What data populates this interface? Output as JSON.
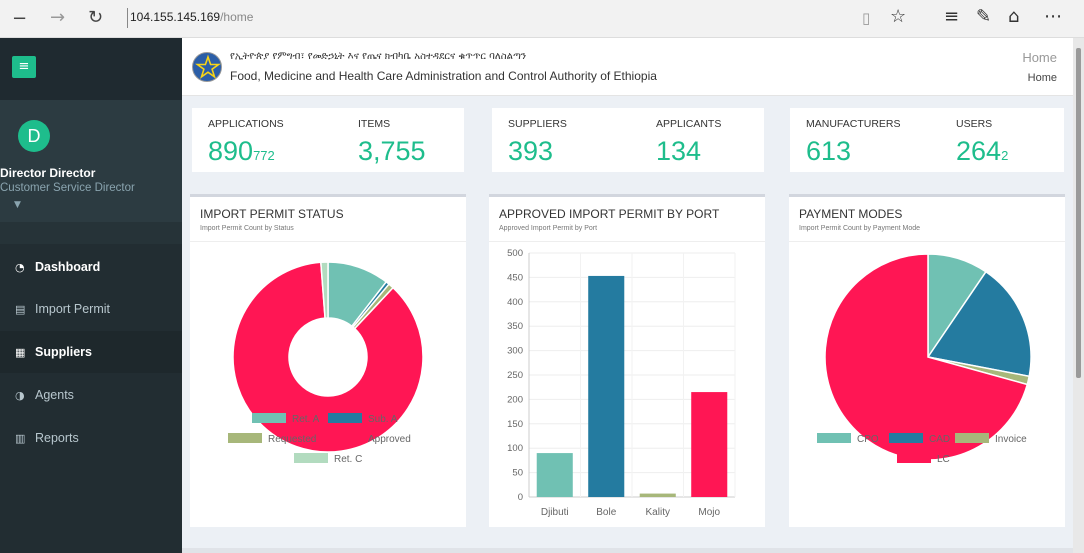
{
  "browser": {
    "url_host": "104.155.145.169",
    "url_path": "/home",
    "icons": [
      "minimize-icon",
      "forward-icon",
      "refresh-icon",
      "reading-view-icon",
      "favorite-star-icon",
      "hub-icon",
      "web-note-icon",
      "share-icon",
      "more-icon"
    ]
  },
  "sidebar": {
    "menu_icon": "≡",
    "user": {
      "initial": "D",
      "name": "Director Director",
      "role": "Customer Service Director"
    },
    "items": [
      {
        "label": "Dashboard",
        "icon": "dashboard-icon"
      },
      {
        "label": "Import Permit",
        "icon": "document-icon"
      },
      {
        "label": "Suppliers",
        "icon": "building-icon"
      },
      {
        "label": "Agents",
        "icon": "half-circle-icon"
      },
      {
        "label": "Reports",
        "icon": "bar-chart-icon"
      }
    ]
  },
  "header": {
    "amharic_title": "የኢትዮጵያ የምግብ፣ የመድኃኒት እና የጤና ክብካቤ አስተዳደርና ቁጥጥር ባለስልጣን",
    "english_title": "Food, Medicine and Health Care Administration and Control Authority of Ethiopia",
    "breadcrumb_title": "Home",
    "breadcrumb_item": "Home"
  },
  "stats": [
    {
      "label": "APPLICATIONS",
      "value": "890",
      "sub": "772"
    },
    {
      "label": "ITEMS",
      "value": "3,755",
      "sub": ""
    },
    {
      "label": "SUPPLIERS",
      "value": "393",
      "sub": ""
    },
    {
      "label": "APPLICANTS",
      "value": "134",
      "sub": ""
    },
    {
      "label": "MANUFACTURERS",
      "value": "613",
      "sub": ""
    },
    {
      "label": "USERS",
      "value": "264",
      "sub": "2"
    }
  ],
  "panels": {
    "status": {
      "title": "IMPORT PERMIT STATUS",
      "subtitle": "Import Permit Count by Status"
    },
    "port": {
      "title": "APPROVED IMPORT PERMIT BY PORT",
      "subtitle": "Approved Import Permit by Port"
    },
    "payment": {
      "title": "PAYMENT MODES",
      "subtitle": "Import Permit Count by Payment Mode"
    }
  },
  "chart_data": [
    {
      "type": "pie",
      "variant": "doughnut",
      "labels": [
        "Ret. A",
        "Sub. A",
        "Requested",
        "Approved",
        "Ret. C"
      ],
      "values": [
        10.5,
        0.6,
        0.9,
        86.8,
        1.2
      ],
      "colors": [
        "#70c1b3",
        "#247ba0",
        "#a7b77a",
        "#ff1654",
        "#b2dbbf"
      ],
      "legend_position": "bottom"
    },
    {
      "type": "bar",
      "categories": [
        "Djibuti",
        "Bole",
        "Kality",
        "Mojo"
      ],
      "values": [
        90,
        453,
        7,
        215
      ],
      "colors": [
        "#70c1b3",
        "#247ba0",
        "#a7b77a",
        "#ff1654"
      ],
      "ylim": [
        0,
        500
      ],
      "yticks": [
        0,
        50,
        100,
        150,
        200,
        250,
        300,
        350,
        400,
        450,
        500
      ],
      "grid": true
    },
    {
      "type": "pie",
      "labels": [
        "CPO",
        "CAD",
        "Invoice",
        "LC"
      ],
      "values": [
        9.5,
        18.5,
        1.3,
        70.7
      ],
      "colors": [
        "#70c1b3",
        "#247ba0",
        "#a7b77a",
        "#ff1654"
      ],
      "legend_position": "bottom"
    }
  ]
}
